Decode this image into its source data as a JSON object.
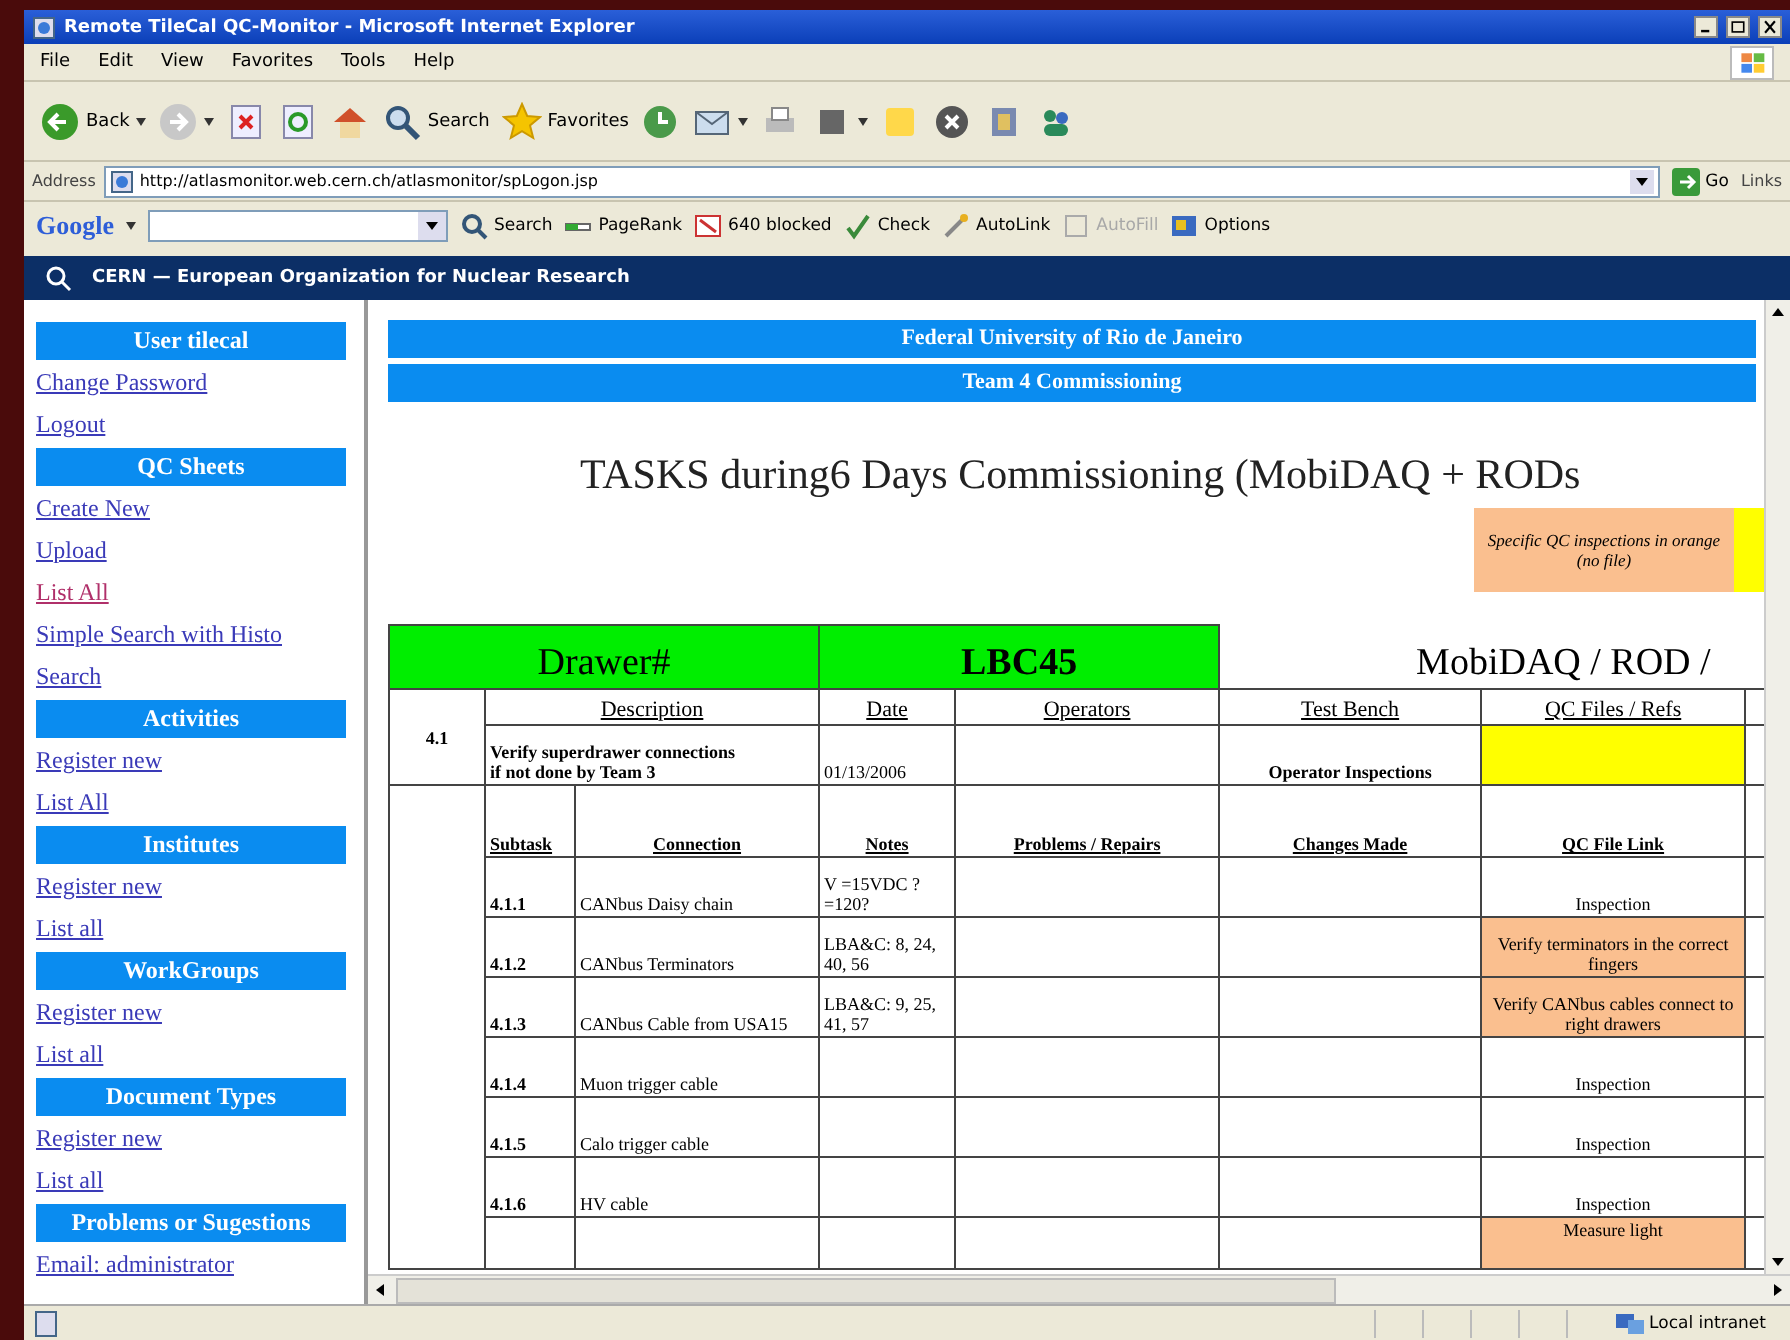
{
  "window": {
    "title": "Remote TileCal QC-Monitor - Microsoft Internet Explorer"
  },
  "menu": [
    "File",
    "Edit",
    "View",
    "Favorites",
    "Tools",
    "Help"
  ],
  "toolbar": [
    {
      "kind": "back",
      "label": "Back"
    },
    {
      "kind": "forward"
    },
    {
      "kind": "stop"
    },
    {
      "kind": "refresh"
    },
    {
      "kind": "home"
    },
    {
      "kind": "search",
      "label": "Search"
    },
    {
      "kind": "favorites",
      "label": "Favorites"
    },
    {
      "kind": "history"
    },
    {
      "kind": "mail"
    },
    {
      "kind": "print"
    },
    {
      "kind": "edit"
    },
    {
      "kind": "note"
    },
    {
      "kind": "block"
    },
    {
      "kind": "media"
    },
    {
      "kind": "messenger"
    }
  ],
  "address": {
    "label": "Address",
    "value": "http://atlasmonitor.web.cern.ch/atlasmonitor/spLogon.jsp",
    "go": "Go",
    "links": "Links"
  },
  "google_toolbar": {
    "logo": "Google",
    "items": [
      {
        "kind": "search",
        "label": "Search",
        "disabled": false
      },
      {
        "kind": "pagerank",
        "label": "PageRank",
        "disabled": false
      },
      {
        "kind": "blocked",
        "label": "640 blocked",
        "disabled": false
      },
      {
        "kind": "check",
        "label": "Check",
        "disabled": false
      },
      {
        "kind": "autolink",
        "label": "AutoLink",
        "disabled": false
      },
      {
        "kind": "autofill",
        "label": "AutoFill",
        "disabled": true
      },
      {
        "kind": "options",
        "label": "Options",
        "disabled": false
      }
    ]
  },
  "site_bar": {
    "title": "CERN — European Organization for Nuclear Research"
  },
  "sidebar": [
    {
      "kind": "header",
      "label": "User tilecal"
    },
    {
      "kind": "link",
      "label": "Change Password",
      "visited": false
    },
    {
      "kind": "link",
      "label": "Logout",
      "visited": false
    },
    {
      "kind": "header",
      "label": "QC Sheets"
    },
    {
      "kind": "link",
      "label": "Create New",
      "visited": false
    },
    {
      "kind": "link",
      "label": "Upload",
      "visited": false
    },
    {
      "kind": "link",
      "label": "List All",
      "visited": true
    },
    {
      "kind": "link",
      "label": "Simple Search with Histo",
      "visited": false
    },
    {
      "kind": "link",
      "label": "Search",
      "visited": false
    },
    {
      "kind": "header",
      "label": "Activities"
    },
    {
      "kind": "link",
      "label": "Register new",
      "visited": false
    },
    {
      "kind": "link",
      "label": "List All",
      "visited": false
    },
    {
      "kind": "header",
      "label": "Institutes"
    },
    {
      "kind": "link",
      "label": "Register new",
      "visited": false
    },
    {
      "kind": "link",
      "label": "List all",
      "visited": false
    },
    {
      "kind": "header",
      "label": "WorkGroups"
    },
    {
      "kind": "link",
      "label": "Register new",
      "visited": false
    },
    {
      "kind": "link",
      "label": "List all",
      "visited": false
    },
    {
      "kind": "header",
      "label": "Document Types"
    },
    {
      "kind": "link",
      "label": "Register new",
      "visited": false
    },
    {
      "kind": "link",
      "label": "List all",
      "visited": false
    },
    {
      "kind": "header",
      "label": "Problems or Sugestions"
    },
    {
      "kind": "link",
      "label": "Email: administrator",
      "visited": false
    }
  ],
  "banners": [
    "Federal University of Rio de Janeiro",
    "Team 4 Commissioning"
  ],
  "page_title": "TASKS during6 Days Commissioning (MobiDAQ + RODs",
  "legend": {
    "text": "Specific QC inspections in orange (no file)"
  },
  "table": {
    "drawer_label": "Drawer#",
    "drawer": "LBC45",
    "section": "MobiDAQ / ROD /",
    "columns": [
      "Description",
      "Date",
      "Operators",
      "Test Bench",
      "QC Files / Refs"
    ],
    "task": {
      "number": "4.1",
      "description": "Verify superdrawer connections\nif not done by Team 3",
      "date": "01/13/2006",
      "test_bench": "Operator Inspections",
      "qc_highlight": true
    },
    "sub_columns": [
      "Subtask",
      "Connection",
      "Notes",
      "Problems / Repairs",
      "Changes Made",
      "QC File Link"
    ],
    "rows": [
      {
        "subtask": "4.1.1",
        "connection": "CANbus Daisy chain",
        "notes": "V =15VDC ? =120?",
        "qc": "Inspection",
        "specific": false
      },
      {
        "subtask": "4.1.2",
        "connection": "CANbus Terminators",
        "notes": "LBA&C: 8, 24, 40, 56",
        "qc": "Verify terminators in the correct fingers",
        "specific": true
      },
      {
        "subtask": "4.1.3",
        "connection": "CANbus Cable from USA15",
        "notes": "LBA&C: 9, 25, 41, 57",
        "qc": "Verify CANbus cables connect to right drawers",
        "specific": true
      },
      {
        "subtask": "4.1.4",
        "connection": "Muon trigger cable",
        "notes": "",
        "qc": "Inspection",
        "specific": false
      },
      {
        "subtask": "4.1.5",
        "connection": "Calo trigger cable",
        "notes": "",
        "qc": "Inspection",
        "specific": false
      },
      {
        "subtask": "4.1.6",
        "connection": "HV cable",
        "notes": "",
        "qc": "Inspection",
        "specific": false
      },
      {
        "subtask": "",
        "connection": "",
        "notes": "",
        "qc": "Measure light",
        "specific": true
      }
    ]
  },
  "status_bar": {
    "zone": "Local intranet"
  }
}
